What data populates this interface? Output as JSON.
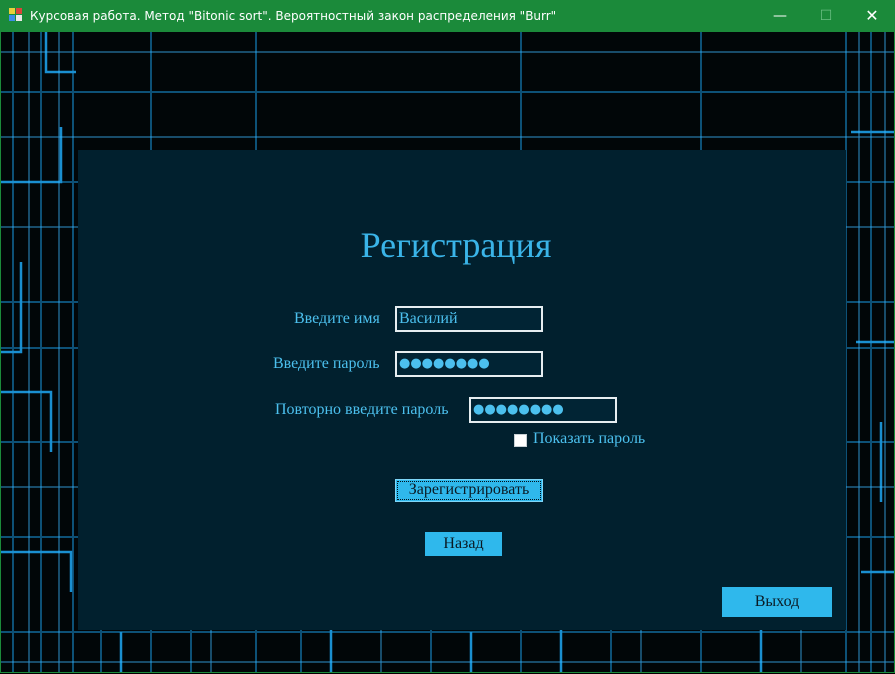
{
  "window": {
    "title": "Курсовая работа. Метод \"Bitonic sort\". Вероятностный закон распределения \"Burr\"",
    "app_icon": "windows-form-icon",
    "minimize_symbol": "—",
    "maximize_symbol": "☐",
    "close_symbol": "✕",
    "titlebar_color": "#1b8a3a"
  },
  "form": {
    "heading": "Регистрация",
    "name_label": "Введите имя",
    "name_value": "Василий",
    "password_label": "Введите пароль",
    "password_mask": "●●●●●●●●",
    "repeat_label": "Повторно введите пароль",
    "repeat_mask": "●●●●●●●●",
    "show_password_label": "Показать пароль",
    "show_password_checked": false,
    "register_button": "Зарегистрировать",
    "back_button": "Назад",
    "exit_button": "Выход"
  },
  "colors": {
    "panel": "#01202e",
    "text": "#4cc0ee",
    "button": "#2fb8ec"
  }
}
